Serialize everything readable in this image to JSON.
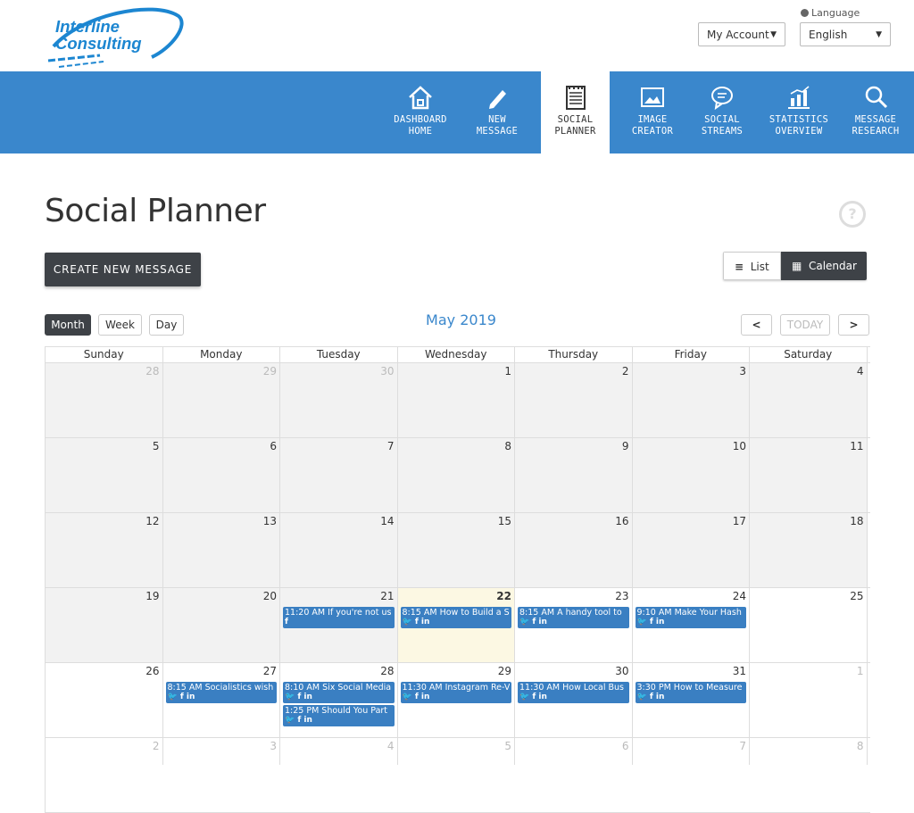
{
  "logo": {
    "line1": "Interline",
    "line2": "Consulting"
  },
  "header": {
    "language_label": "Language",
    "account_label": "My Account",
    "language_value": "English"
  },
  "nav": [
    {
      "line1": "DASHBOARD",
      "line2": "HOME",
      "icon": "home-icon"
    },
    {
      "line1": "NEW",
      "line2": "MESSAGE",
      "icon": "pencil-icon"
    },
    {
      "line1": "SOCIAL",
      "line2": "PLANNER",
      "icon": "planner-icon"
    },
    {
      "line1": "IMAGE",
      "line2": "CREATOR",
      "icon": "image-icon"
    },
    {
      "line1": "SOCIAL",
      "line2": "STREAMS",
      "icon": "chat-bubble-icon"
    },
    {
      "line1": "STATISTICS",
      "line2": "OVERVIEW",
      "icon": "bar-chart-icon"
    },
    {
      "line1": "MESSAGE",
      "line2": "RESEARCH",
      "icon": "magnifier-icon"
    }
  ],
  "page": {
    "title": "Social Planner",
    "help": "?",
    "create_button": "CREATE NEW MESSAGE",
    "view_list": "List",
    "view_calendar": "Calendar"
  },
  "calendar": {
    "month_label": "May 2019",
    "modes": [
      "Month",
      "Week",
      "Day"
    ],
    "today_label": "TODAY",
    "prev": "<",
    "next": ">",
    "weekdays": [
      "Sunday",
      "Monday",
      "Tuesday",
      "Wednesday",
      "Thursday",
      "Friday",
      "Saturday"
    ],
    "weeks": [
      [
        "28",
        "29",
        "30",
        "1",
        "2",
        "3",
        "4"
      ],
      [
        "5",
        "6",
        "7",
        "8",
        "9",
        "10",
        "11"
      ],
      [
        "12",
        "13",
        "14",
        "15",
        "16",
        "17",
        "18"
      ],
      [
        "19",
        "20",
        "21",
        "22",
        "23",
        "24",
        "25"
      ],
      [
        "26",
        "27",
        "28",
        "29",
        "30",
        "31",
        "1"
      ],
      [
        "2",
        "3",
        "4",
        "5",
        "6",
        "7",
        "8"
      ]
    ],
    "events": {
      "3-2": [
        {
          "text": "11:20 AM If you're not us",
          "networks": "f"
        }
      ],
      "3-3": [
        {
          "text": "8:15 AM How to Build a S",
          "networks": "🐦 f in"
        }
      ],
      "3-4": [
        {
          "text": "8:15 AM A handy tool to",
          "networks": "🐦 f in"
        }
      ],
      "3-5": [
        {
          "text": "9:10 AM Make Your Hash",
          "networks": "🐦 f in"
        }
      ],
      "4-1": [
        {
          "text": "8:15 AM Socialistics wish",
          "networks": "🐦 f in"
        }
      ],
      "4-2": [
        {
          "text": "8:10 AM Six Social Media",
          "networks": "🐦 f in"
        },
        {
          "text": "1:25 PM Should You Part",
          "networks": "🐦 f in"
        }
      ],
      "4-3": [
        {
          "text": "11:30 AM Instagram Re-V",
          "networks": "🐦 f in"
        }
      ],
      "4-4": [
        {
          "text": "11:30 AM How Local Bus",
          "networks": "🐦 f in"
        }
      ],
      "4-5": [
        {
          "text": "3:30 PM How to Measure",
          "networks": "🐦 f in"
        }
      ]
    }
  }
}
